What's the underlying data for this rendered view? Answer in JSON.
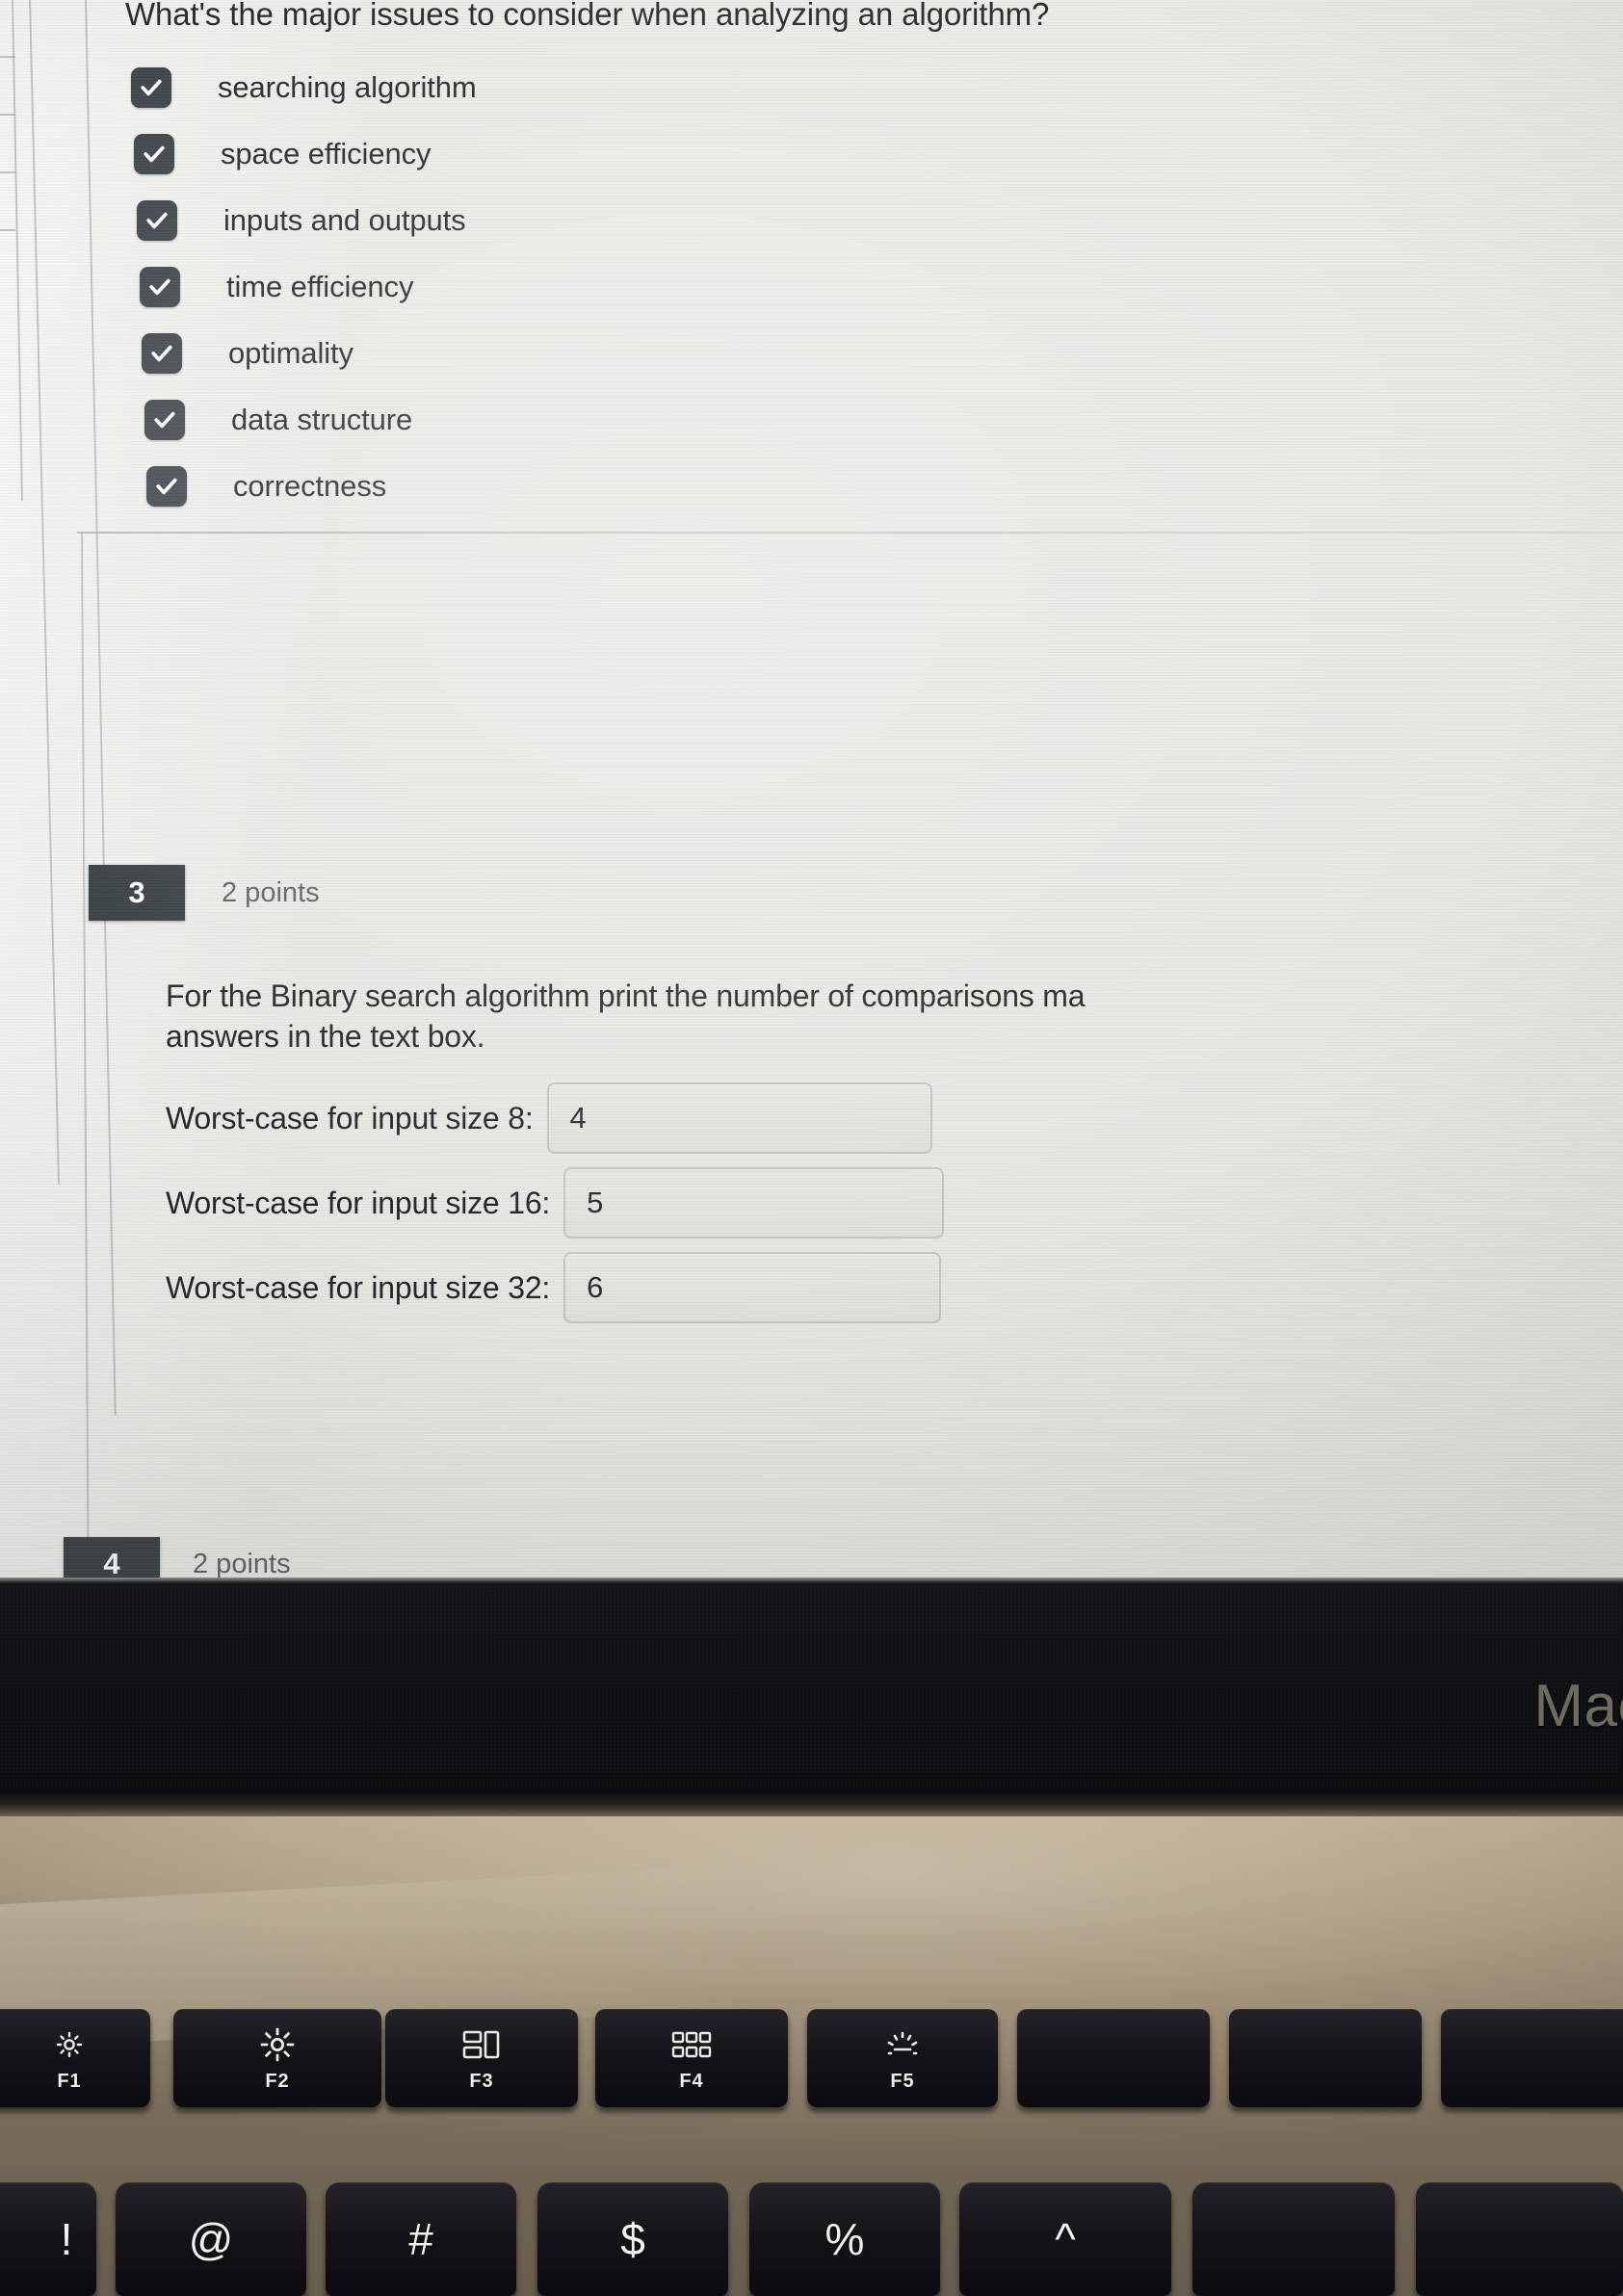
{
  "quiz": {
    "question2": {
      "prompt": "What's the major issues to consider when analyzing an algorithm?",
      "options": [
        {
          "label": "searching algorithm",
          "checked": true
        },
        {
          "label": "space efficiency",
          "checked": true
        },
        {
          "label": "inputs and outputs",
          "checked": true
        },
        {
          "label": "time efficiency",
          "checked": true
        },
        {
          "label": "optimality",
          "checked": true
        },
        {
          "label": "data structure",
          "checked": true
        },
        {
          "label": "correctness",
          "checked": true
        }
      ]
    },
    "question3": {
      "number": "3",
      "points": "2 points",
      "text_line1": "For the Binary search algorithm print the number of comparisons ma",
      "text_line2": "answers in the text box.",
      "answers": [
        {
          "label": "Worst-case for input size 8:",
          "value": "4",
          "placeholder": ""
        },
        {
          "label": "Worst-case for input size 16:",
          "value": "5",
          "placeholder": ""
        },
        {
          "label": "Worst-case for input size 32:",
          "value": "6",
          "placeholder": ""
        }
      ]
    },
    "question4": {
      "number": "4",
      "points": "2 points"
    }
  },
  "laptop": {
    "brand_text": "Mac",
    "function_keys": [
      {
        "label": "F1",
        "icon": "brightness-down-icon"
      },
      {
        "label": "F2",
        "icon": "brightness-up-icon"
      },
      {
        "label": "F3",
        "icon": "mission-control-icon"
      },
      {
        "label": "F4",
        "icon": "launchpad-icon"
      },
      {
        "label": "F5",
        "icon": "keyboard-backlight-icon"
      },
      {
        "label": "",
        "icon": ""
      }
    ],
    "symbol_keys": [
      {
        "symbol": "!"
      },
      {
        "symbol": "@"
      },
      {
        "symbol": "#"
      },
      {
        "symbol": "$"
      },
      {
        "symbol": "%"
      },
      {
        "symbol": "^"
      }
    ]
  },
  "colors": {
    "checkbox_fill": "#383f44",
    "question_badge": "#2b3236",
    "screen_bg": "#e6e6e2",
    "text": "#1d1f22",
    "muted_text": "#53575a",
    "input_border": "#c0c2bf",
    "key_face": "#141418",
    "deck": "#9a8b74"
  }
}
